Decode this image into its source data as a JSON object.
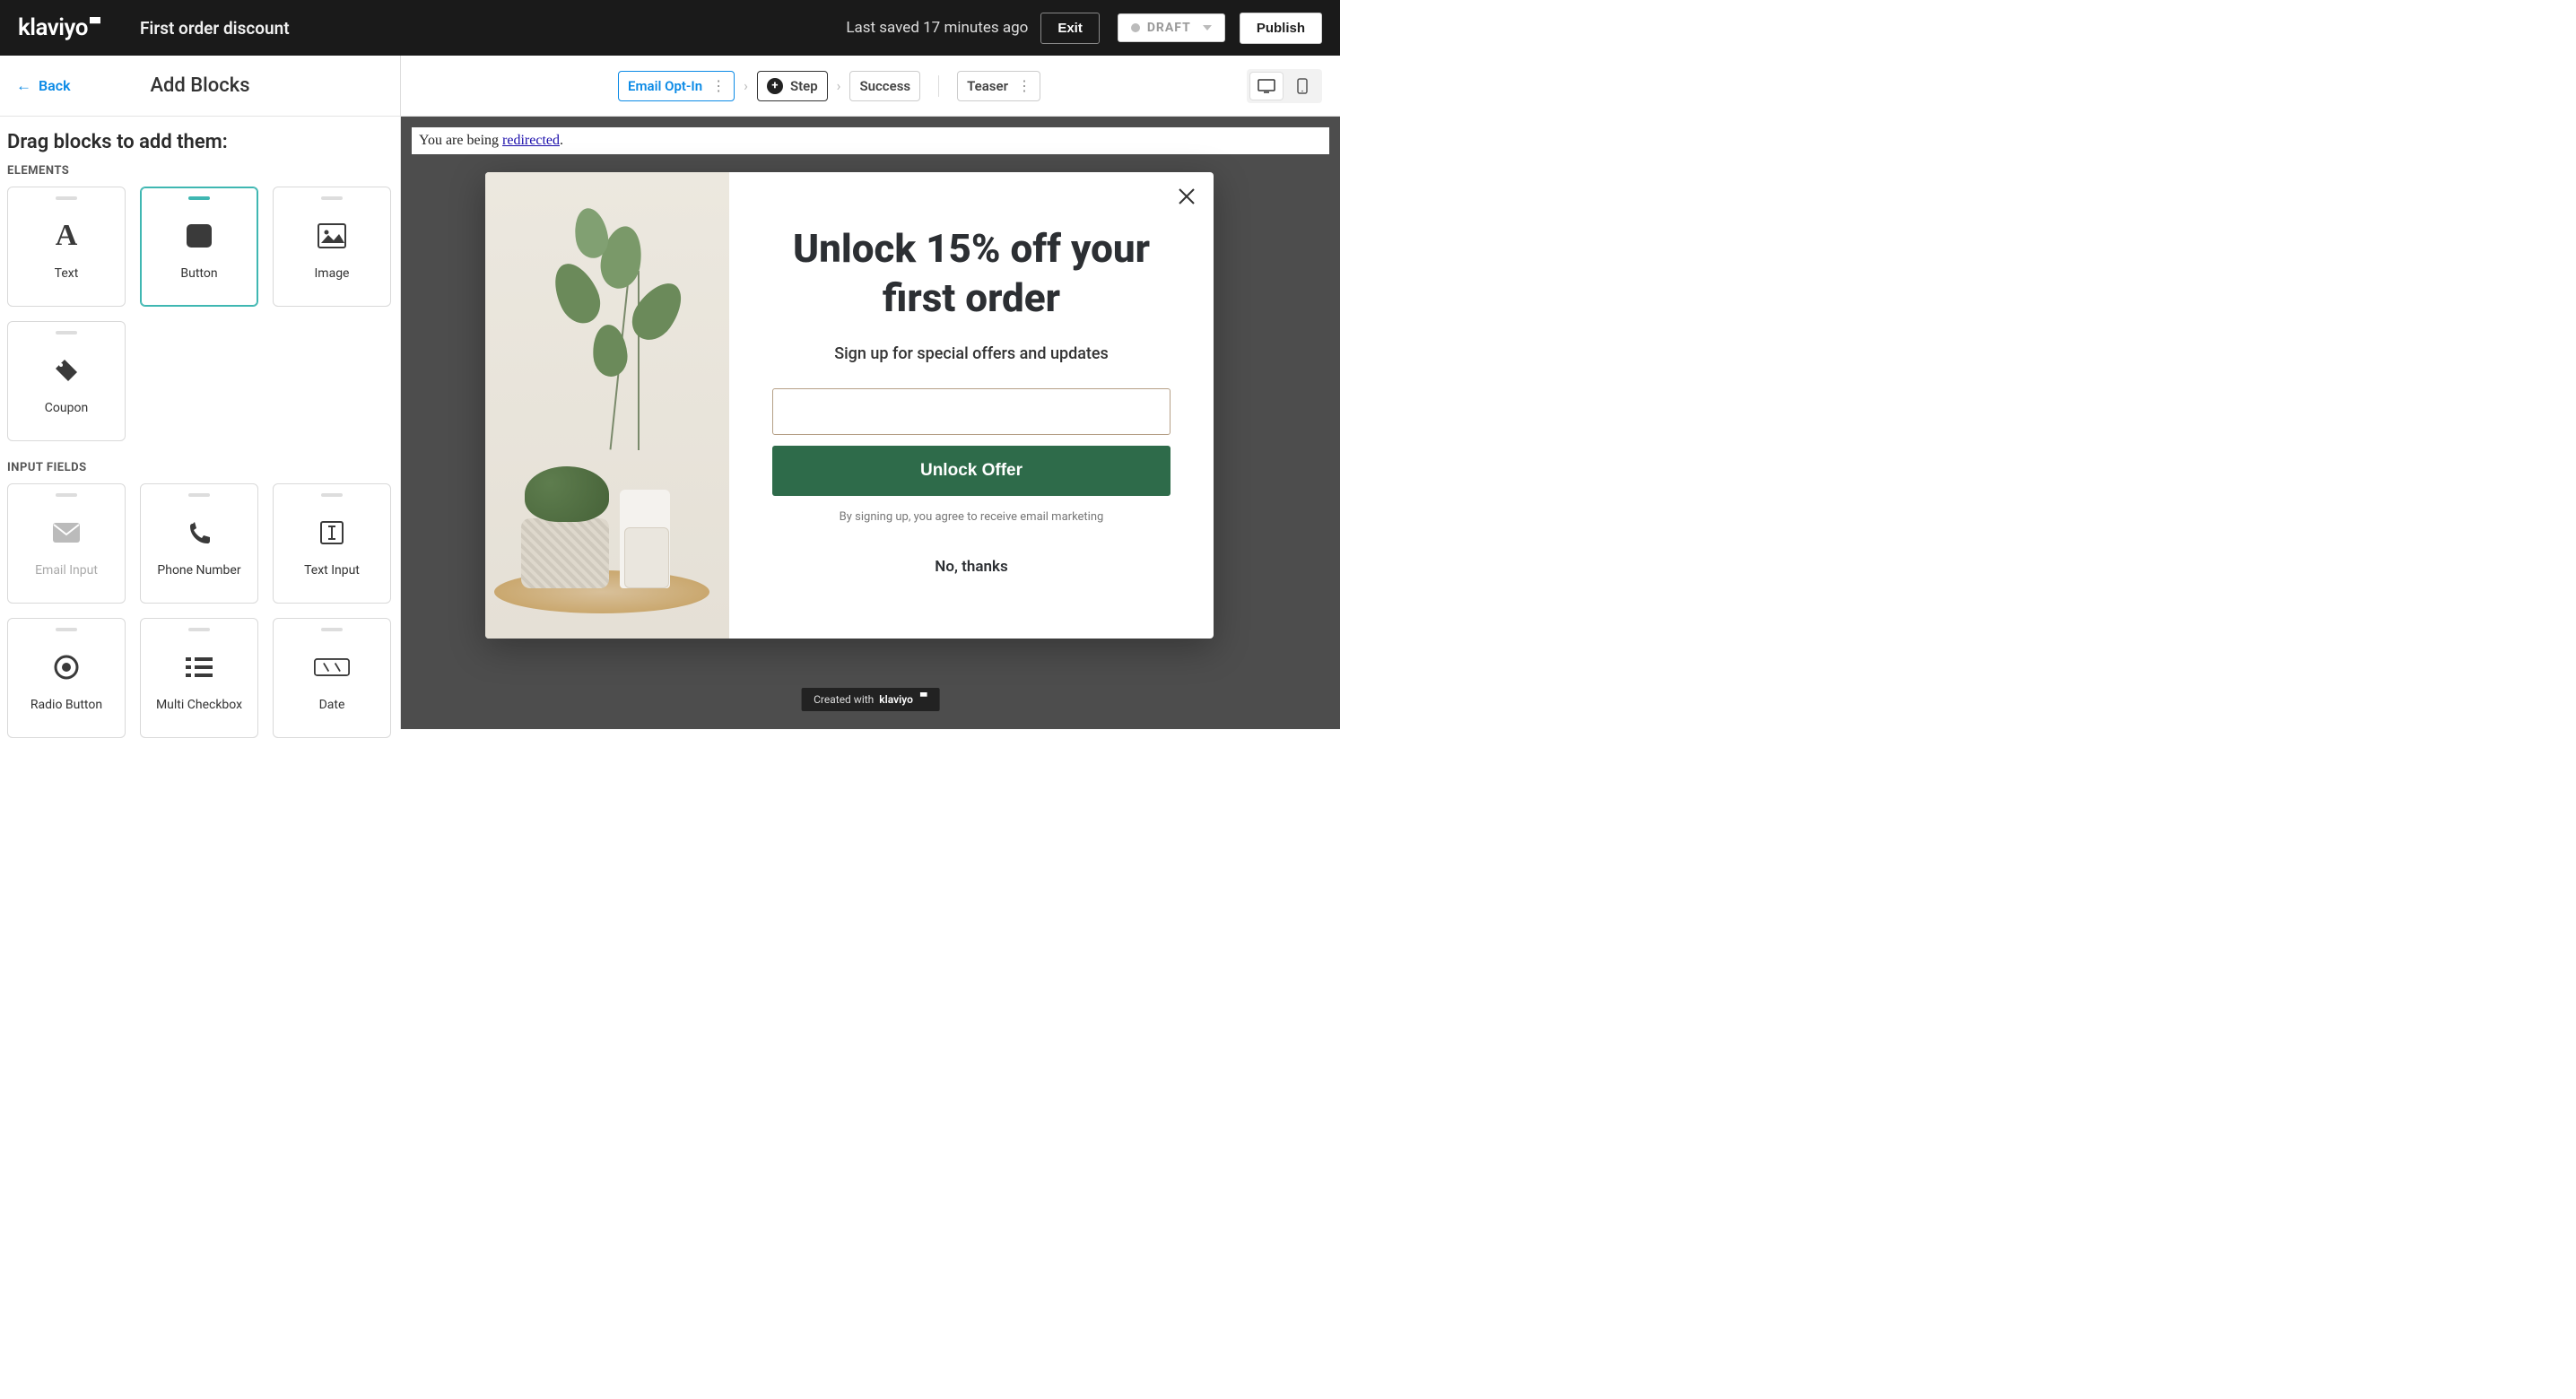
{
  "header": {
    "logo_text": "klaviyo",
    "doc_title": "First order discount",
    "saved_text": "Last saved 17 minutes ago",
    "exit_label": "Exit",
    "status_label": "DRAFT",
    "publish_label": "Publish"
  },
  "sidebar": {
    "back_label": "Back",
    "title": "Add Blocks",
    "drag_heading": "Drag blocks to add them:",
    "sections": {
      "elements_label": "ELEMENTS",
      "inputs_label": "INPUT FIELDS"
    },
    "elements": [
      {
        "label": "Text"
      },
      {
        "label": "Button"
      },
      {
        "label": "Image"
      },
      {
        "label": "Coupon"
      }
    ],
    "inputs": [
      {
        "label": "Email Input"
      },
      {
        "label": "Phone Number"
      },
      {
        "label": "Text Input"
      },
      {
        "label": "Radio Button"
      },
      {
        "label": "Multi Checkbox"
      },
      {
        "label": "Date"
      }
    ]
  },
  "stepper": {
    "email_optin": "Email Opt-In",
    "step": "Step",
    "success": "Success",
    "teaser": "Teaser"
  },
  "canvas": {
    "redirect_prefix": "You are being ",
    "redirect_link": "redirected",
    "redirect_suffix": "."
  },
  "popup": {
    "headline": "Unlock 15% off your first order",
    "subhead": "Sign up for special offers and updates",
    "input_placeholder": "",
    "cta": "Unlock Offer",
    "legal": "By signing up, you agree to receive email marketing",
    "dismiss": "No, thanks"
  },
  "credit": {
    "prefix": "Created with",
    "brand": "klaviyo"
  }
}
